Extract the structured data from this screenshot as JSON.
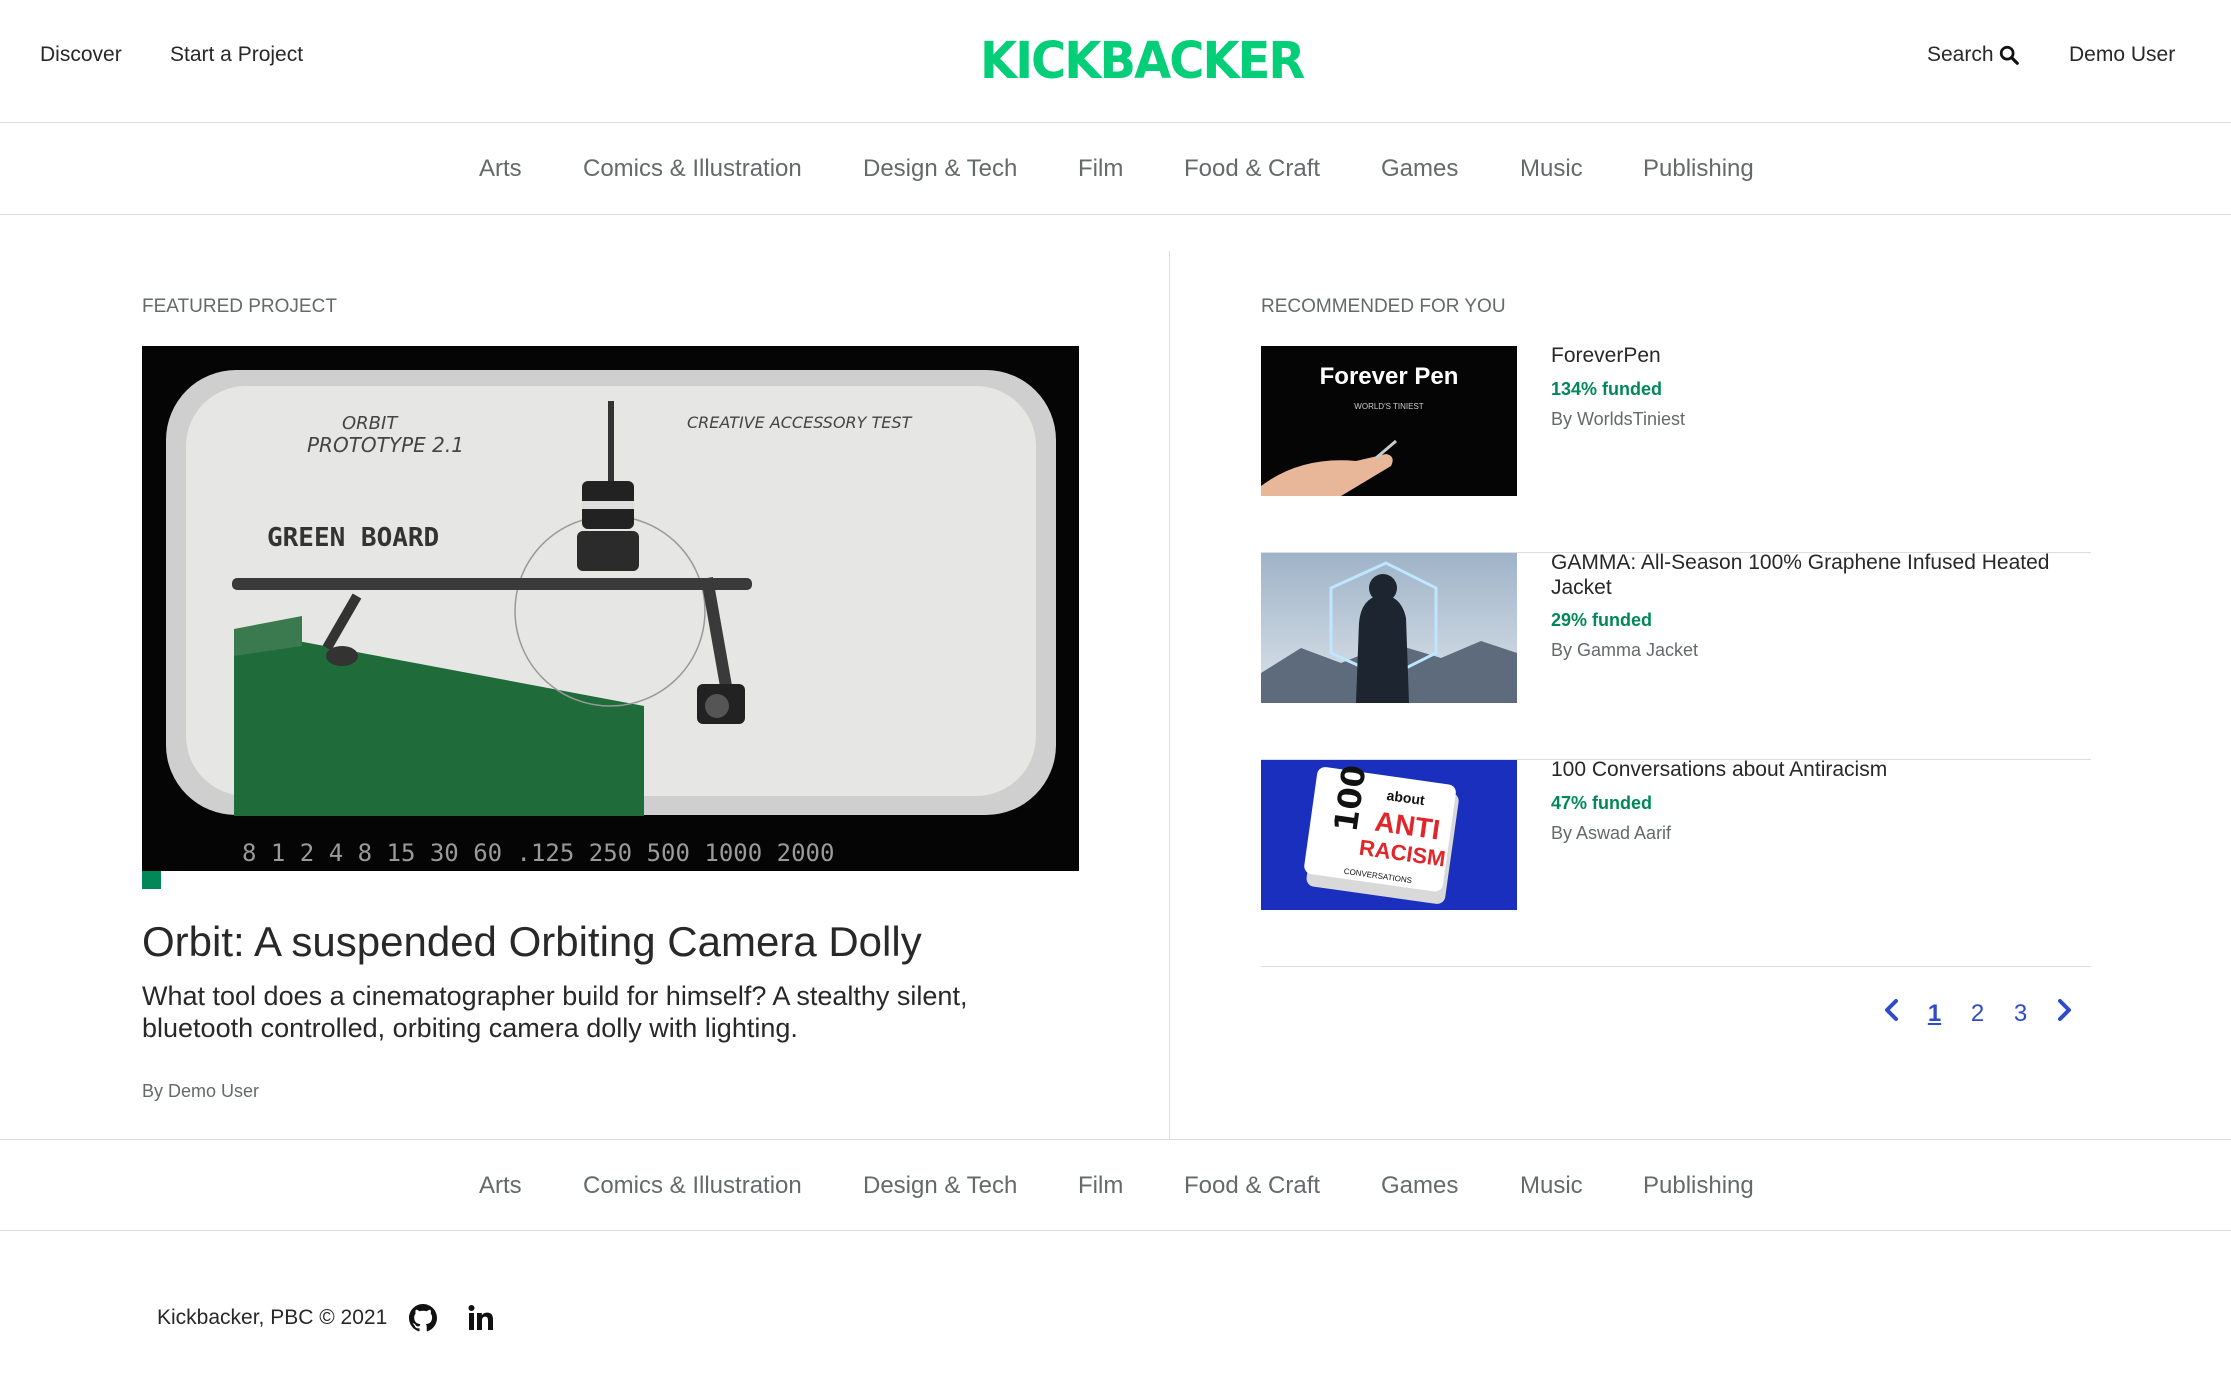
{
  "header": {
    "discover": "Discover",
    "start_project": "Start a Project",
    "logo": "KICKBACKER",
    "search": "Search",
    "user": "Demo User"
  },
  "categories": [
    "Arts",
    "Comics & Illustration",
    "Design & Tech",
    "Film",
    "Food & Craft",
    "Games",
    "Music",
    "Publishing"
  ],
  "featured": {
    "label": "FEATURED PROJECT",
    "title": "Orbit: A suspended Orbiting Camera Dolly",
    "description": "What tool does a cinematographer build for himself? A stealthy silent, bluetooth controlled, orbiting camera dolly with lighting.",
    "by": "By Demo User",
    "funded_fraction": 0.02,
    "image_text": {
      "prototype_line1": "ORBIT",
      "prototype_line2": "PROTOTYPE 2.1",
      "test": "CREATIVE ACCESSORY TEST",
      "board": "GREEN BOARD",
      "scale": "8  1  2  4  8  15  30  60 .125  250  500  1000  2000"
    }
  },
  "recommended": {
    "label": "RECOMMENDED FOR YOU",
    "items": [
      {
        "title": "ForeverPen",
        "funded": "134% funded",
        "by": "By WorldsTiniest",
        "thumb_text": "Forever Pen",
        "thumb_sub": "WORLD'S TINIEST"
      },
      {
        "title": "GAMMA: All-Season 100% Graphene Infused Heated Jacket",
        "funded": "29% funded",
        "by": "By Gamma Jacket"
      },
      {
        "title": "100 Conversations about Antiracism",
        "funded": "47% funded",
        "by": "By Aswad Aarif",
        "thumb_num": "100",
        "thumb_about": "about",
        "thumb_anti": "ANTI",
        "thumb_racism": "RACISM",
        "thumb_conv": "CONVERSATIONS"
      }
    ]
  },
  "pager": {
    "pages": [
      "1",
      "2",
      "3"
    ],
    "current": "1"
  },
  "footer": {
    "copyright": "Kickbacker, PBC © 2021"
  },
  "colors": {
    "brand_green": "#05ce78",
    "funded_green": "#028858",
    "link_blue": "#2e4bc9"
  },
  "icons": [
    "search-icon",
    "chevron-left-icon",
    "chevron-right-icon",
    "github-icon",
    "linkedin-icon"
  ]
}
